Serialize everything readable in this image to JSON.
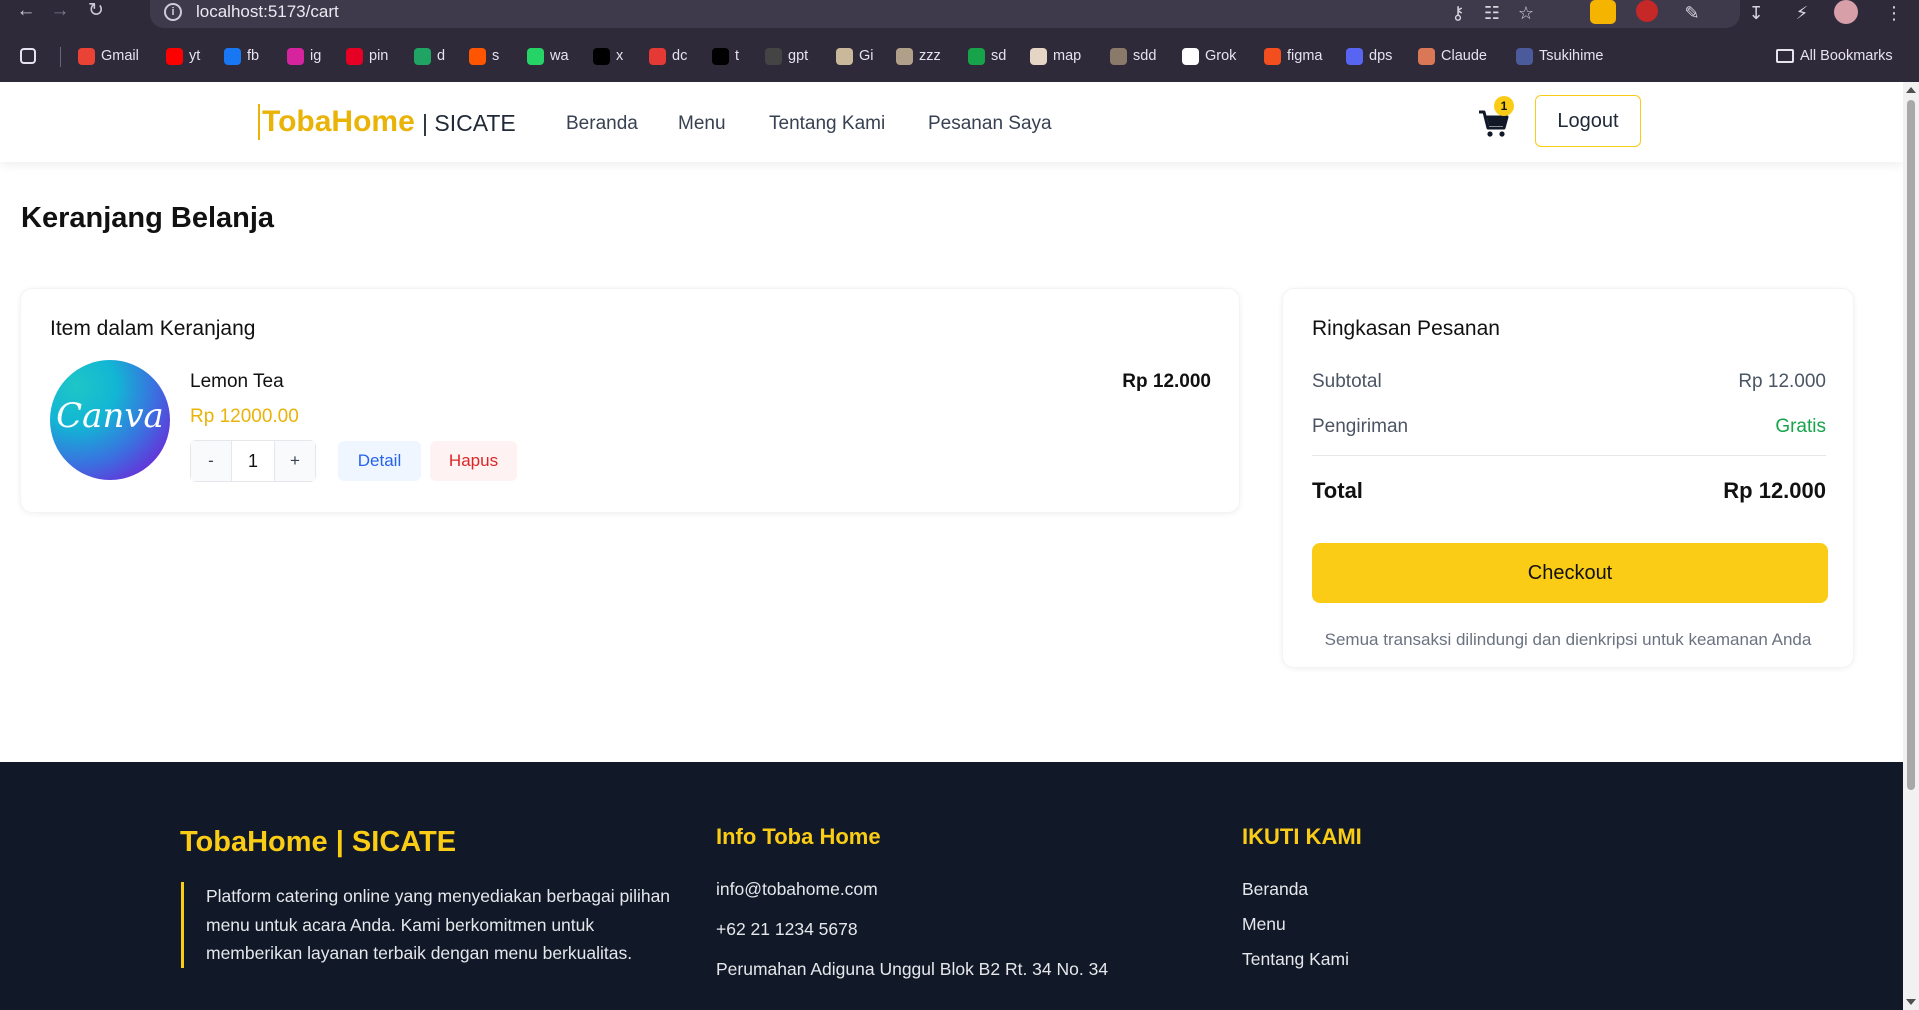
{
  "browser": {
    "url": "localhost:5173/cart",
    "bookmarks": [
      {
        "label": "Gmail",
        "color": "#ea4335"
      },
      {
        "label": "yt",
        "color": "#ff0000"
      },
      {
        "label": "fb",
        "color": "#1877f2"
      },
      {
        "label": "ig",
        "color": "#d6249f"
      },
      {
        "label": "pin",
        "color": "#e60023"
      },
      {
        "label": "d",
        "color": "#1fa463"
      },
      {
        "label": "s",
        "color": "#ff5500"
      },
      {
        "label": "wa",
        "color": "#25d366"
      },
      {
        "label": "x",
        "color": "#000000"
      },
      {
        "label": "dc",
        "color": "#e53935"
      },
      {
        "label": "t",
        "color": "#010101"
      },
      {
        "label": "gpt",
        "color": "#444444"
      },
      {
        "label": "Gi",
        "color": "#c9b89a"
      },
      {
        "label": "zzz",
        "color": "#b0a08a"
      },
      {
        "label": "sd",
        "color": "#16a34a"
      },
      {
        "label": "map",
        "color": "#e5d5c5"
      },
      {
        "label": "sdd",
        "color": "#8a7a6a"
      },
      {
        "label": "Grok",
        "color": "#ffffff"
      },
      {
        "label": "figma",
        "color": "#f24e1e"
      },
      {
        "label": "dps",
        "color": "#5865f2"
      },
      {
        "label": "Claude",
        "color": "#d97757"
      },
      {
        "label": "Tsukihime",
        "color": "#4a5a9a"
      }
    ],
    "all_bookmarks": "All Bookmarks"
  },
  "header": {
    "logo": "TobaHome",
    "logo_sub": "| SICATE",
    "nav": [
      "Beranda",
      "Menu",
      "Tentang Kami",
      "Pesanan Saya"
    ],
    "cart_count": "1",
    "logout": "Logout"
  },
  "page_title": "Keranjang Belanja",
  "cart": {
    "title": "Item dalam Keranjang",
    "items": [
      {
        "thumb_text": "Canva",
        "name": "Lemon Tea",
        "unit_price": "Rp 12000.00",
        "line_total": "Rp 12.000",
        "qty": "1",
        "minus": "-",
        "plus": "+",
        "detail": "Detail",
        "remove": "Hapus"
      }
    ]
  },
  "summary": {
    "title": "Ringkasan Pesanan",
    "subtotal_label": "Subtotal",
    "subtotal_value": "Rp 12.000",
    "shipping_label": "Pengiriman",
    "shipping_value": "Gratis",
    "total_label": "Total",
    "total_value": "Rp 12.000",
    "checkout": "Checkout",
    "note": "Semua transaksi dilindungi dan dienkripsi untuk keamanan Anda"
  },
  "footer": {
    "brand": "TobaHome | SICATE",
    "description": "Platform catering online yang menyediakan berbagai pilihan menu untuk acara Anda. Kami berkomitmen untuk memberikan layanan terbaik dengan menu berkualitas.",
    "info_title": "Info Toba Home",
    "email": "info@tobahome.com",
    "phone": "+62 21 1234 5678",
    "address": "Perumahan Adiguna Unggul Blok B2 Rt. 34 No. 34",
    "follow_title": "IKUTI KAMI",
    "links": [
      "Beranda",
      "Menu",
      "Tentang Kami"
    ]
  },
  "colors": {
    "accent": "#facc15",
    "brand_text": "#eab308",
    "footer_bg": "#111827",
    "free_shipping": "#16a34a"
  }
}
